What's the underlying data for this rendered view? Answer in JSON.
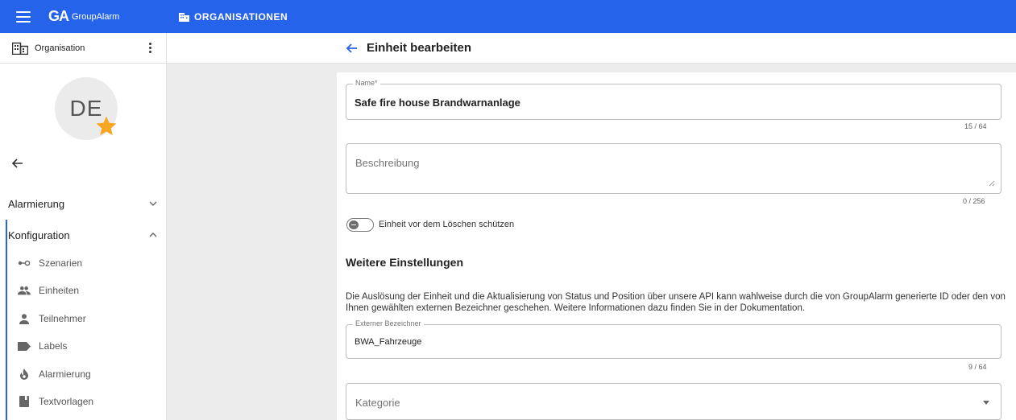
{
  "app": {
    "logo_mark": "GA",
    "logo_name": "GroupAlarm",
    "section_title": "ORGANISATIONEN"
  },
  "sidebar": {
    "org_label": "Organisation",
    "avatar_initials": "DE",
    "groups": [
      {
        "label": "Alarmierung",
        "expanded": false
      },
      {
        "label": "Konfiguration",
        "expanded": true
      }
    ],
    "items": [
      {
        "label": "Szenarien",
        "icon": "scenario-icon"
      },
      {
        "label": "Einheiten",
        "icon": "units-icon"
      },
      {
        "label": "Teilnehmer",
        "icon": "person-icon"
      },
      {
        "label": "Labels",
        "icon": "label-icon"
      },
      {
        "label": "Alarmierung",
        "icon": "flame-icon"
      },
      {
        "label": "Textvorlagen",
        "icon": "book-icon"
      }
    ]
  },
  "main": {
    "title": "Einheit bearbeiten",
    "name_field": {
      "legend": "Name*",
      "value": "Safe fire house Brandwarnanlage",
      "counter": "15 / 64"
    },
    "description_field": {
      "placeholder": "Beschreibung",
      "counter": "0 / 256"
    },
    "protect_toggle": {
      "label": "Einheit vor dem Löschen schützen",
      "checked": false
    },
    "further_settings": {
      "heading": "Weitere Einstellungen",
      "text": "Die Auslösung der Einheit und die Aktualisierung von Status und Position über unsere API kann wahlweise durch die von GroupAlarm generierte ID oder den von Ihnen gewählten externen Bezeichner geschehen. Weitere Informationen dazu finden Sie in der Dokumentation."
    },
    "external_field": {
      "legend": "Externer Bezeichner",
      "value": "BWA_Fahrzeuge",
      "counter": "9 / 64"
    },
    "category_field": {
      "placeholder": "Kategorie"
    }
  },
  "colors": {
    "primary": "#2563eb",
    "star": "#f5a623",
    "background": "#ececec"
  }
}
